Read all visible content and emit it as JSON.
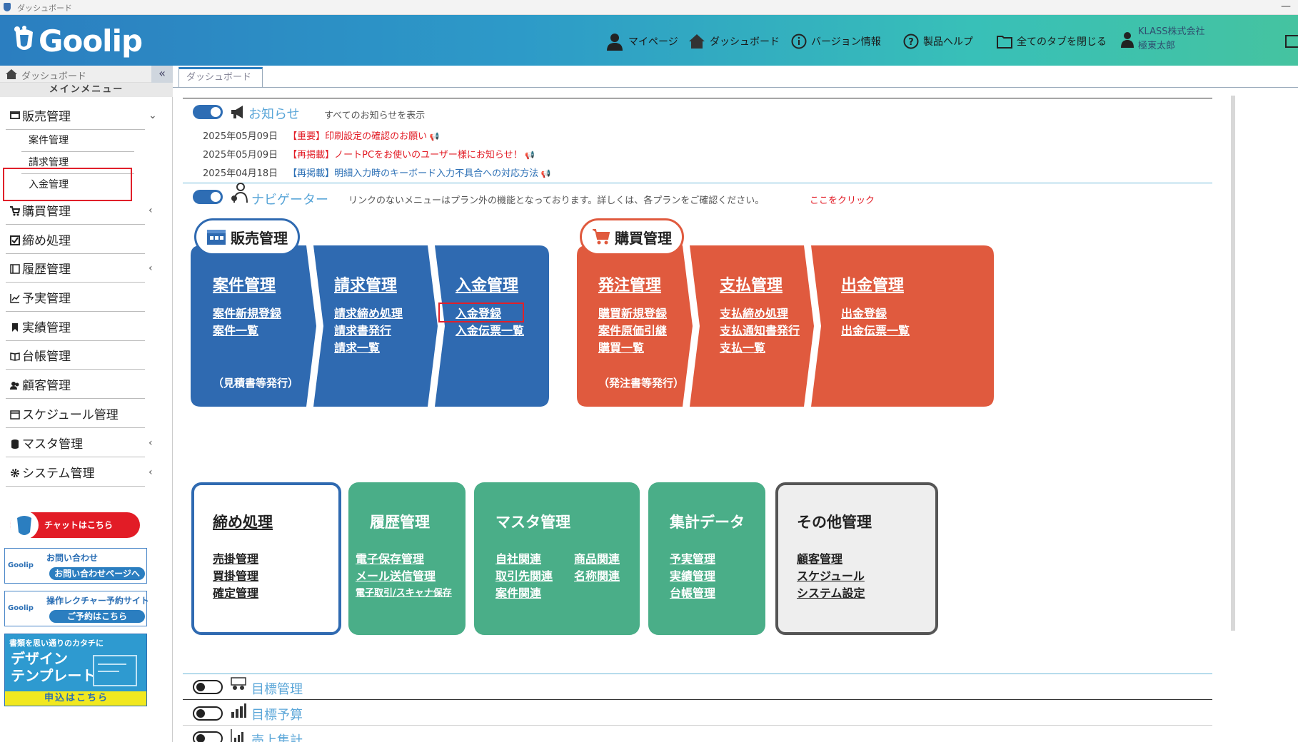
{
  "window": {
    "title": "ダッシュボード"
  },
  "header": {
    "logo": "Goolip",
    "nav": {
      "mypage": "マイページ",
      "dashboard": "ダッシュボード",
      "version": "バージョン情報",
      "help": "製品ヘルプ",
      "close_tabs": "全てのタブを閉じる"
    },
    "user": {
      "company": "KLASS株式会社",
      "name": "極東太郎"
    }
  },
  "sidebar": {
    "top_label": "ダッシュボード",
    "main_menu": "メインメニュー",
    "collapse_icon": "«",
    "items": [
      {
        "label": "販売管理",
        "icon": "register-icon",
        "chev": "⌄"
      },
      {
        "label": "購買管理",
        "icon": "cart-icon",
        "chev": "‹"
      },
      {
        "label": "締め処理",
        "icon": "checkbox-icon",
        "chev": ""
      },
      {
        "label": "履歴管理",
        "icon": "history-icon",
        "chev": "‹"
      },
      {
        "label": "予実管理",
        "icon": "chart-icon",
        "chev": ""
      },
      {
        "label": "実績管理",
        "icon": "bookmark-icon",
        "chev": ""
      },
      {
        "label": "台帳管理",
        "icon": "book-icon",
        "chev": ""
      },
      {
        "label": "顧客管理",
        "icon": "users-icon",
        "chev": ""
      },
      {
        "label": "スケジュール管理",
        "icon": "calendar-icon",
        "chev": ""
      },
      {
        "label": "マスタ管理",
        "icon": "database-icon",
        "chev": "‹"
      },
      {
        "label": "システム管理",
        "icon": "gear-icon",
        "chev": "‹"
      }
    ],
    "sub_items": [
      "案件管理",
      "請求管理",
      "入金管理"
    ],
    "chat_label": "チャットはこちら",
    "contact": {
      "logo": "Goolip",
      "title": "お問い合わせ",
      "button": "お問い合わせページへ"
    },
    "lecture": {
      "logo": "Goolip",
      "title": "操作レクチャー予約サイト",
      "button": "ご予約はこちら"
    },
    "design": {
      "top": "書類を思い通りのカタチに",
      "big": "デザイン\nテンプレート",
      "button": "申込はこちら"
    }
  },
  "content": {
    "tab_label": "ダッシュボード",
    "notice": {
      "title": "お知らせ",
      "show_all": "すべてのお知らせを表示",
      "items": [
        {
          "date": "2025年05月09日",
          "text": "【重要】印刷設定の確認のお願い",
          "color": "#e21c26"
        },
        {
          "date": "2025年05月09日",
          "text": "【再掲載】ノートPCをお使いのユーザー様にお知らせ！",
          "color": "#e21c26"
        },
        {
          "date": "2025年04月18日",
          "text": "【再掲載】明細入力時のキーボード入力不具合への対応方法",
          "color": "#2b6fb5"
        }
      ]
    },
    "navigator": {
      "title": "ナビゲーター",
      "note": "リンクのないメニューはプラン外の機能となっております。詳しくは、各プランをご確認ください。",
      "click_here": "ここをクリック"
    },
    "sales": {
      "badge": "販売管理",
      "cards": [
        {
          "title": "案件管理",
          "links": [
            "案件新規登録",
            "案件一覧"
          ],
          "note": "（見積書等発行）"
        },
        {
          "title": "請求管理",
          "links": [
            "請求締め処理",
            "請求書発行",
            "請求一覧"
          ],
          "note": ""
        },
        {
          "title": "入金管理",
          "links": [
            "入金登録",
            "入金伝票一覧"
          ],
          "note": ""
        }
      ]
    },
    "purchase": {
      "badge": "購買管理",
      "cards": [
        {
          "title": "発注管理",
          "links": [
            "購買新規登録",
            "案件原価引継",
            "購買一覧"
          ],
          "note": "（発注書等発行）"
        },
        {
          "title": "支払管理",
          "links": [
            "支払締め処理",
            "支払通知書発行",
            "支払一覧"
          ],
          "note": ""
        },
        {
          "title": "出金管理",
          "links": [
            "出金登録",
            "出金伝票一覧"
          ],
          "note": ""
        }
      ]
    },
    "lower": {
      "closing": {
        "title": "締め処理",
        "links": [
          "売掛管理",
          "買掛管理",
          "確定管理"
        ]
      },
      "history": {
        "title": "履歴管理",
        "links": [
          "電子保存管理",
          "メール送信管理",
          "電子取引/スキャナ保存"
        ]
      },
      "master": {
        "title": "マスタ管理",
        "links_left": [
          "自社関連",
          "取引先関連",
          "案件関連"
        ],
        "links_right": [
          "商品関連",
          "名称関連"
        ]
      },
      "aggregate": {
        "title": "集計データ",
        "links": [
          "予実管理",
          "実績管理",
          "台帳管理"
        ]
      },
      "other": {
        "title": "その他管理",
        "links": [
          "顧客管理",
          "スケジュール",
          "システム設定"
        ]
      }
    },
    "bottom_sections": [
      "目標管理",
      "目標予算",
      "売上集計"
    ]
  },
  "colors": {
    "sales_blue": "#2f6ab1",
    "purchase_red": "#e05a3e",
    "green": "#4aae88",
    "highlight_red": "#e0202a"
  }
}
